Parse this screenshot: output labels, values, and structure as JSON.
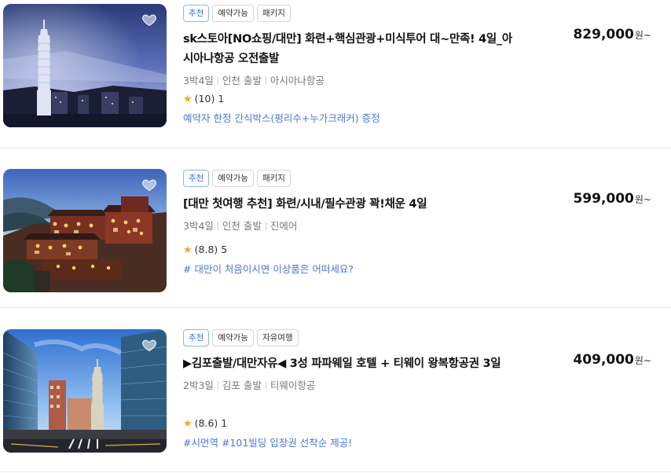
{
  "products": [
    {
      "tags": [
        "추천",
        "예약가능",
        "패키지"
      ],
      "title": "sk스토아[NO쇼핑/대만] 화련+핵심관광+미식투어 대~만족! 4일_아시아나항공 오전출발",
      "duration": "3박4일",
      "departure": "인천 출발",
      "airline": "아시아나항공",
      "rating": "(10)",
      "reviews": "1",
      "promo": "예약자 한정 간식박스(펑리수+누가크래커) 증정",
      "price": "829,000",
      "price_unit": "원~"
    },
    {
      "tags": [
        "추천",
        "예약가능",
        "패키지"
      ],
      "title": "[대만 첫여행 추천] 화련/시내/필수관광 꽉!채운 4일",
      "duration": "3박4일",
      "departure": "인천 출발",
      "airline": "진에어",
      "rating": "(8.8)",
      "reviews": "5",
      "promo": "# 대만이 처음이시면 이상품은 어떠세요?",
      "price": "599,000",
      "price_unit": "원~"
    },
    {
      "tags": [
        "추천",
        "예약가능",
        "자유여행"
      ],
      "title": "▶김포출발/대만자유◀ 3성 파파웨일 호텔 + 티웨이 왕복항공권 3일",
      "duration": "2박3일",
      "departure": "김포 출발",
      "airline": "티웨이항공",
      "rating": "(8.6)",
      "reviews": "1",
      "promo": "#시먼역 #101빌딩 입장권 선착순 제공!",
      "price": "409,000",
      "price_unit": "원~"
    }
  ],
  "colors": {
    "accent_tag": "#2d6fe0",
    "promo_text": "#4a78d6",
    "star": "#f5a623"
  },
  "icons": {
    "wishlist": "heart-icon",
    "rating": "star-icon"
  }
}
